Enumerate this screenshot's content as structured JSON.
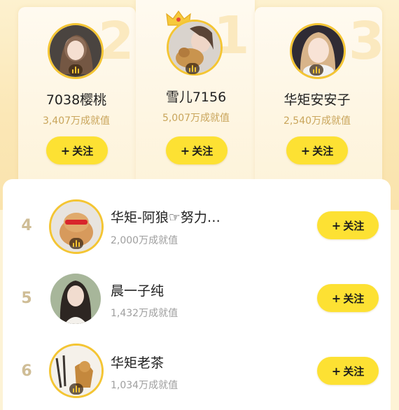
{
  "top3": [
    {
      "rank": "2",
      "name": "7038樱桃",
      "value": "3,407万成就值",
      "follow_label": "关注"
    },
    {
      "rank": "1",
      "name": "雪儿7156",
      "value": "5,007万成就值",
      "follow_label": "关注"
    },
    {
      "rank": "3",
      "name": "华矩安安子",
      "value": "2,540万成就值",
      "follow_label": "关注"
    }
  ],
  "list": [
    {
      "rank": "4",
      "name": "华矩-阿狼☞努力…",
      "value": "2,000万成就值",
      "follow_label": "关注"
    },
    {
      "rank": "5",
      "name": "晨一子纯",
      "value": "1,432万成就值",
      "follow_label": "关注"
    },
    {
      "rank": "6",
      "name": "华矩老茶",
      "value": "1,034万成就值",
      "follow_label": "关注"
    }
  ],
  "plus_symbol": "+",
  "colors": {
    "accent": "#fde133",
    "gold_border": "#f4c533",
    "value_text": "#c9a55b"
  }
}
